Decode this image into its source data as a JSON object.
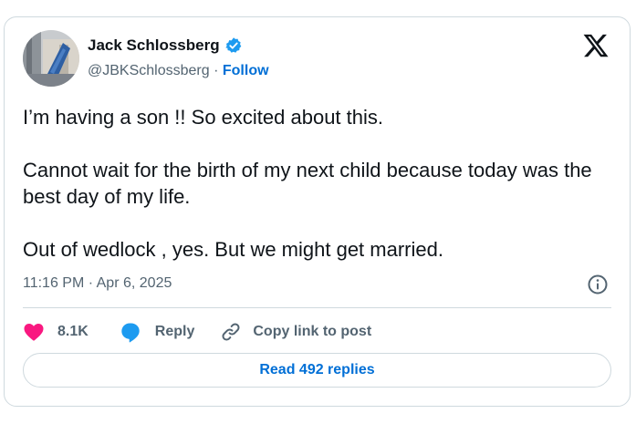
{
  "author": {
    "name": "Jack Schlossberg",
    "handle": "@JBKSchlossberg",
    "separator": "·",
    "follow_label": "Follow"
  },
  "tweet": {
    "paragraphs": [
      "I’m having a son !! So excited about this.",
      "Cannot wait for the birth of my next child because today was the best day of my life.",
      "Out of wedlock , yes. But we might get married."
    ],
    "timestamp": "11:16 PM · Apr 6, 2025"
  },
  "actions": {
    "like_count": "8.1K",
    "reply_label": "Reply",
    "copy_label": "Copy link to post"
  },
  "replies_button": "Read 492 replies",
  "colors": {
    "accent": "#1d9bf0",
    "link": "#006fd6",
    "like": "#f91880",
    "muted": "#536471",
    "border": "#cfd9de"
  },
  "icons": [
    "verified-badge-icon",
    "x-logo-icon",
    "info-icon",
    "heart-icon",
    "reply-bubble-icon",
    "link-icon"
  ]
}
